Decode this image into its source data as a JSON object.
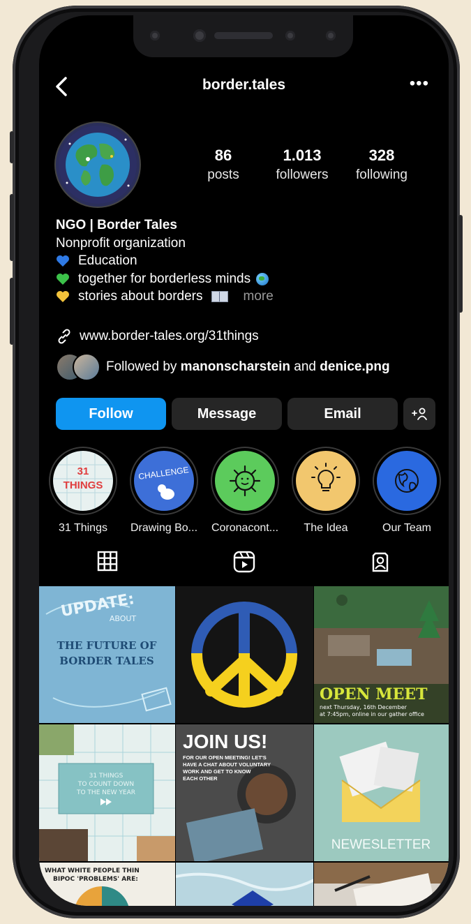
{
  "header": {
    "back_icon": "chevron-left-icon",
    "username": "border.tales",
    "more_icon": "ellipsis-icon"
  },
  "stats": [
    {
      "value": "86",
      "label": "posts"
    },
    {
      "value": "1.013",
      "label": "followers"
    },
    {
      "value": "328",
      "label": "following"
    }
  ],
  "bio": {
    "name": "NGO | Border Tales",
    "category": "Nonprofit organization",
    "lines": [
      {
        "heart_color": "#2f7ae5",
        "text": "Education"
      },
      {
        "heart_color": "#3cc24a",
        "text": "together for borderless minds"
      },
      {
        "heart_color": "#f2c23b",
        "text": "stories about borders"
      }
    ],
    "more": "more",
    "link": "www.border-tales.org/31things"
  },
  "followed_by": {
    "prefix": "Followed by",
    "user1": "manonscharstein",
    "conj": "and",
    "user2": "denice.png"
  },
  "buttons": {
    "follow": "Follow",
    "message": "Message",
    "email": "Email",
    "add_icon": "add-person-icon"
  },
  "highlights": [
    {
      "label": "31 Things",
      "cover_text": "31 THINGS"
    },
    {
      "label": "Drawing Bo...",
      "cover_text": "CHALLENGE"
    },
    {
      "label": "Coronacont...",
      "cover_text": ""
    },
    {
      "label": "The Idea",
      "cover_text": ""
    },
    {
      "label": "Our Team",
      "cover_text": ""
    }
  ],
  "tabs": [
    "grid-icon",
    "reels-icon",
    "tagged-icon"
  ],
  "posts": {
    "p1": {
      "line1": "UPDATE:",
      "line2": "ABOUT",
      "line3": "THE FUTURE OF",
      "line4": "BORDER TALES"
    },
    "p3": {
      "title": "OPEN MEET",
      "sub1": "next Thursday, 16th December",
      "sub2": "at 7:45pm, online in our gather office"
    },
    "p4": {
      "line1": "31 THINGS",
      "line2": "TO COUNT DOWN",
      "line3": "TO THE NEW YEAR"
    },
    "p5": {
      "title": "JOIN US!",
      "body1": "FOR OUR OPEN MEETING! LET'S",
      "body2": "HAVE A CHAT ABOUT VOLUNTARY",
      "body3": "WORK AND GET TO KNOW",
      "body4": "EACH OTHER"
    },
    "p6": {
      "title": "NEWESLETTER"
    },
    "p7": {
      "line1": "WHAT WHITE PEOPLE THIN",
      "line2": "BIPOC 'PROBLEMS' ARE:"
    }
  },
  "colors": {
    "follow_blue": "#0f95f0",
    "button_gray": "#262626",
    "background": "#000000"
  }
}
